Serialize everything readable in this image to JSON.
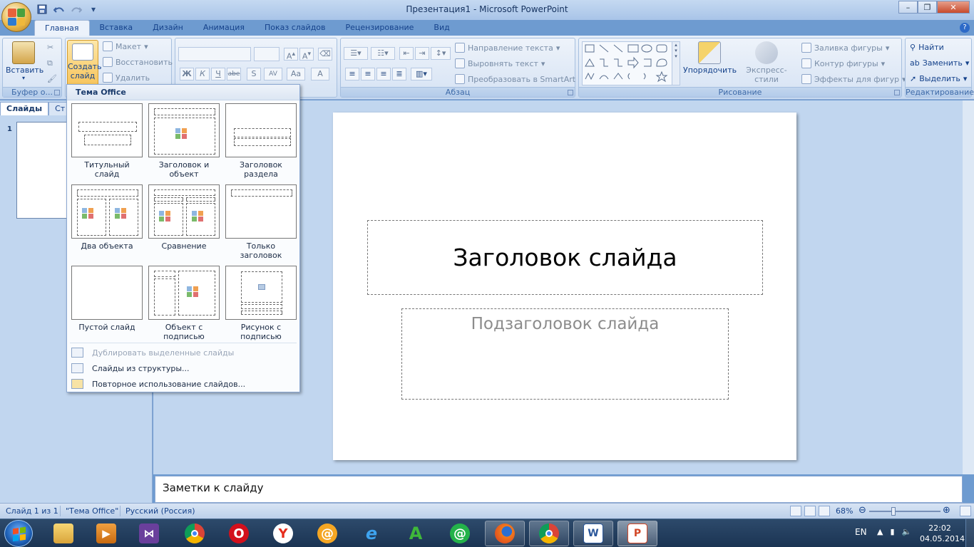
{
  "window": {
    "title": "Презентация1 - Microsoft PowerPoint",
    "minimize_label": "–",
    "maximize_label": "❐",
    "close_label": "✕"
  },
  "qat": {
    "save_icon": "save-icon",
    "undo_icon": "undo-icon",
    "redo_icon": "redo-icon",
    "customize_icon": "chevron-down-icon"
  },
  "ribbon_tabs": [
    "Главная",
    "Вставка",
    "Дизайн",
    "Анимация",
    "Показ слайдов",
    "Рецензирование",
    "Вид"
  ],
  "ribbon": {
    "clipboard": {
      "label": "Буфер о...",
      "paste": "Вставить"
    },
    "slides": {
      "new_slide_line1": "Создать",
      "new_slide_line2": "слайд",
      "layout": "Макет",
      "reset": "Восстановить",
      "delete": "Удалить"
    },
    "font": {
      "bold": "Ж",
      "italic": "К",
      "underline": "Ч",
      "strike": "abe",
      "shadow": "S",
      "spacing": "AV",
      "case": "Aa",
      "color": "A"
    },
    "paragraph": {
      "label": "Абзац",
      "text_direction": "Направление текста",
      "align_text": "Выровнять текст",
      "smartart": "Преобразовать в SmartArt"
    },
    "drawing": {
      "label": "Рисование",
      "arrange": "Упорядочить",
      "quick_styles": "Экспресс-стили",
      "fill": "Заливка фигуры",
      "outline": "Контур фигуры",
      "effects": "Эффекты для фигур"
    },
    "editing": {
      "label": "Редактирование",
      "find": "Найти",
      "replace": "Заменить",
      "select": "Выделить"
    }
  },
  "left_panel": {
    "tabs": [
      "Слайды",
      "Ст"
    ],
    "slide_number": "1"
  },
  "slide": {
    "title": "Заголовок слайда",
    "subtitle": "Подзаголовок слайда"
  },
  "notes_placeholder": "Заметки к слайду",
  "status": {
    "slide_info": "Слайд 1 из 1",
    "theme": "\"Тема Office\"",
    "language": "Русский (Россия)",
    "zoom": "68%"
  },
  "dropdown": {
    "header": "Тема Office",
    "layouts": [
      {
        "label": "Титульный слайд"
      },
      {
        "label": "Заголовок и объект"
      },
      {
        "label": "Заголовок раздела"
      },
      {
        "label": "Два объекта"
      },
      {
        "label": "Сравнение"
      },
      {
        "label": "Только заголовок"
      },
      {
        "label": "Пустой слайд"
      },
      {
        "label": "Объект с подписью"
      },
      {
        "label": "Рисунок с подписью"
      }
    ],
    "commands": {
      "duplicate": "Дублировать выделенные слайды",
      "from_outline": "Слайды из структуры...",
      "reuse": "Повторное использование слайдов..."
    }
  },
  "taskbar": {
    "lang": "EN",
    "time": "22:02",
    "date": "04.05.2014",
    "apps": [
      "explorer",
      "media-player",
      "visual-studio",
      "chrome",
      "opera",
      "yandex",
      "mail-agent",
      "internet-explorer",
      "a-app",
      "icq",
      "firefox",
      "chrome-2",
      "word",
      "powerpoint"
    ]
  },
  "colors": {
    "ribbon_bg": "#dbe6f5",
    "workspace_bg": "#c1d6ef",
    "taskbar_bg": "#1b3453"
  }
}
